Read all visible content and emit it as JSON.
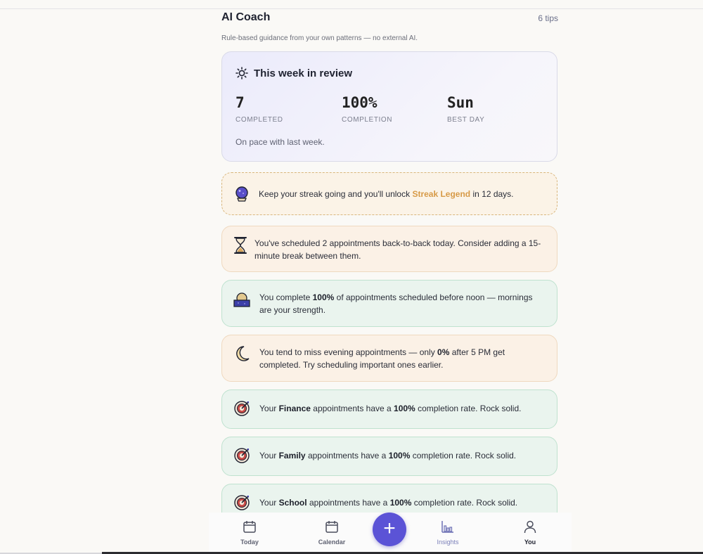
{
  "header": {
    "title": "AI Coach",
    "tips_count": "6 tips",
    "subtitle": "Rule-based guidance from your own patterns — no external AI."
  },
  "review": {
    "title": "This week in review",
    "stats": [
      {
        "value": "7",
        "label": "COMPLETED"
      },
      {
        "value": "100%",
        "label": "COMPLETION"
      },
      {
        "value": "Sun",
        "label": "BEST DAY"
      }
    ],
    "note": "On pace with last week."
  },
  "streak": {
    "prefix": "Keep your streak going and you'll unlock ",
    "highlight": "Streak Legend",
    "suffix": " in 12 days.",
    "icon": "crystal-ball-icon",
    "highlight_color": "#d79a47"
  },
  "tips": [
    {
      "icon": "hourglass-icon",
      "parts": [
        "You've scheduled 2 appointments back-to-back today. Consider adding a 15-minute break between them."
      ]
    },
    {
      "icon": "sunrise-icon",
      "parts": [
        "You complete ",
        "100%",
        " of appointments scheduled before noon — mornings are your strength."
      ]
    },
    {
      "icon": "moon-icon",
      "parts": [
        "You tend to miss evening appointments — only ",
        "0%",
        " after 5 PM get completed. Try scheduling important ones earlier."
      ]
    },
    {
      "icon": "target-icon",
      "parts": [
        "Your ",
        "Finance",
        " appointments have a ",
        "100%",
        " completion rate. Rock solid."
      ]
    },
    {
      "icon": "target-icon",
      "parts": [
        "Your ",
        "Family",
        " appointments have a ",
        "100%",
        " completion rate. Rock solid."
      ]
    },
    {
      "icon": "target-icon",
      "parts": [
        "Your ",
        "School",
        " appointments have a ",
        "100%",
        " completion rate. Rock solid."
      ]
    }
  ],
  "nav": {
    "items": [
      {
        "label": "Today",
        "icon": "calendar-day-icon"
      },
      {
        "label": "Calendar",
        "icon": "calendar-icon"
      },
      {
        "label": "Insights",
        "icon": "bar-chart-icon"
      },
      {
        "label": "You",
        "icon": "user-icon"
      }
    ],
    "fab_symbol": "+"
  },
  "colors": {
    "accent": "#5b53d6",
    "warm_card": "#fbf1e6",
    "green_card": "#eaf4ee"
  }
}
